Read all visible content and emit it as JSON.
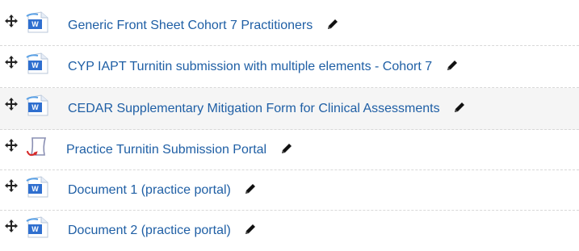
{
  "activities": [
    {
      "title": "Generic Front Sheet Cohort 7 Practitioners",
      "icon": "word-document-icon"
    },
    {
      "title": "CYP IAPT Turnitin submission with multiple elements - Cohort 7",
      "icon": "word-document-icon"
    },
    {
      "title": "CEDAR Supplementary Mitigation Form for Clinical Assessments",
      "icon": "word-document-icon"
    },
    {
      "title": "Practice Turnitin Submission Portal",
      "icon": "turnitin-assignment-icon"
    },
    {
      "title": "Document 1 (practice portal)",
      "icon": "word-document-icon"
    },
    {
      "title": "Document 2 (practice portal)",
      "icon": "word-document-icon"
    }
  ],
  "colors": {
    "link": "#1f5fa5",
    "highlight_row": "#f5f5f5",
    "divider": "#d8d8d8"
  },
  "icons": {
    "move": "move-arrows-icon",
    "edit": "pencil-icon"
  }
}
